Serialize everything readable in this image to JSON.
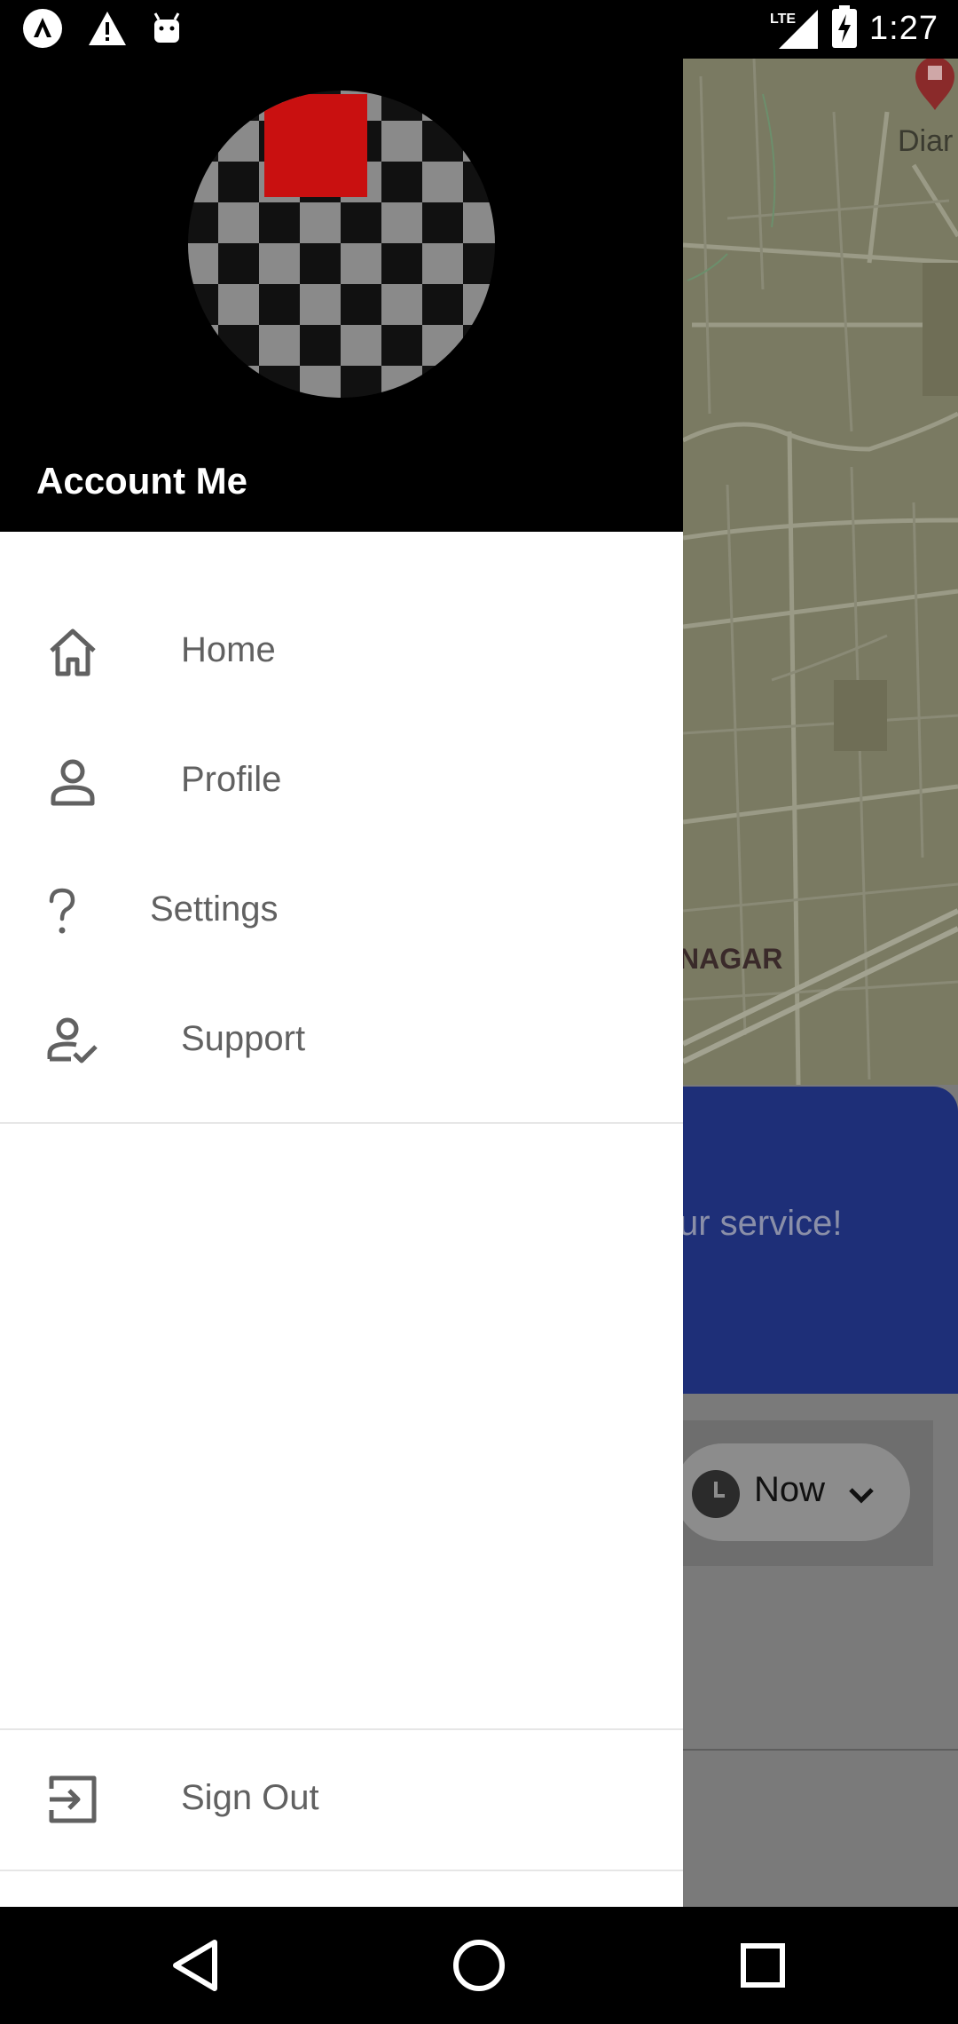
{
  "status_bar": {
    "time": "1:27",
    "network": "LTE",
    "left_icons": [
      "app-notification-icon",
      "warning-icon",
      "android-icon"
    ],
    "right_icons": [
      "lte-signal-icon",
      "battery-charging-icon"
    ]
  },
  "drawer": {
    "account_name": "Account Me",
    "menu": [
      {
        "label": "Home",
        "icon": "home-icon"
      },
      {
        "label": "Profile",
        "icon": "person-icon"
      },
      {
        "label": "Settings",
        "icon": "question-mark-icon"
      },
      {
        "label": "Support",
        "icon": "person-check-icon"
      }
    ],
    "sign_out": {
      "label": "Sign Out",
      "icon": "sign-out-icon"
    }
  },
  "background": {
    "map_label": "NAGAR",
    "map_label_partial": "Diar",
    "card_text": "ur service!",
    "time_selector": "Now"
  },
  "colors": {
    "drawer_header": "#000000",
    "menu_text": "#616161",
    "card_blue": "#1e2f78",
    "avatar_red": "#c91010"
  },
  "nav_bar": {
    "buttons": [
      "back-icon",
      "home-circle-icon",
      "recents-icon"
    ]
  }
}
